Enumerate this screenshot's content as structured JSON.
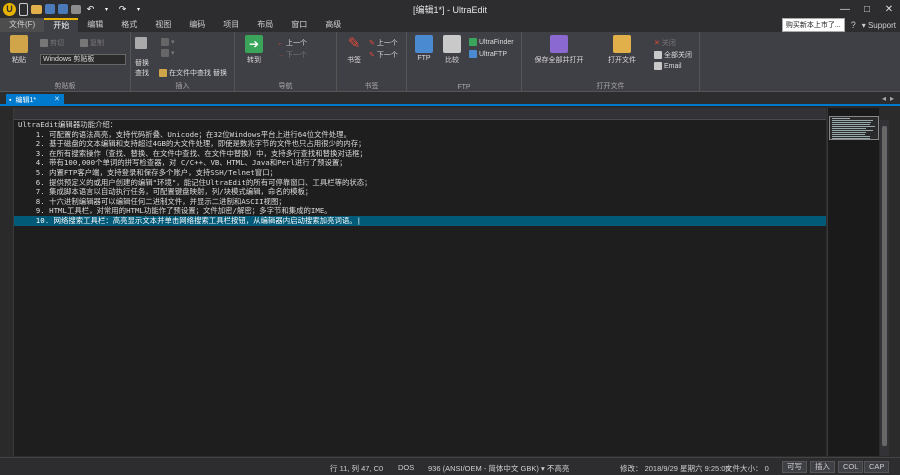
{
  "window": {
    "title": "[编辑1*] - UltraEdit",
    "controls": [
      "—",
      "□",
      "✕"
    ]
  },
  "menu": {
    "items": [
      "文件(F)",
      "开始",
      "编辑",
      "格式",
      "视图",
      "编码",
      "项目",
      "布局",
      "窗口",
      "高级"
    ],
    "active_index": 1,
    "promo": "购买新本上市了...",
    "support": "Support"
  },
  "ribbon": {
    "groups": [
      {
        "label": "剪贴板"
      },
      {
        "label": "插入"
      },
      {
        "label": "导航"
      },
      {
        "label": "书签"
      },
      {
        "label": "FTP"
      },
      {
        "label": "打开文件"
      }
    ],
    "clipboard": {
      "paste": "粘贴",
      "cut": "剪切",
      "copy": "复制",
      "combo": "Windows 剪贴板"
    },
    "insert": {
      "replace": "替换",
      "find": "查找",
      "find_in_files": "在文件中查找 替换"
    },
    "navigation": {
      "goto": "转到",
      "prev": "上一个",
      "next": "下一个"
    },
    "bookmarks": {
      "toggle": "书签",
      "prev": "上一个",
      "next": "下一个"
    },
    "ftp": {
      "ftp": "FTP",
      "compare": "比较",
      "ultrafinder": "UltraFinder",
      "ultraftp": "UltraFTP"
    },
    "open": {
      "save_to_project": "保存全部并打开",
      "open_file": "打开文件",
      "close": "关闭",
      "email": "Email",
      "close_all": "全部关闭"
    }
  },
  "tab": {
    "label": "编辑1*",
    "close": "✕"
  },
  "editor": {
    "lines": [
      "UltraEdit编辑器功能介绍：",
      "    1. 可配置的语法高亮，支持代码折叠、Unicode；在32位Windows平台上进行64位文件处理。",
      "    2. 基于磁盘的文本编辑和支持超过4GB的大文件处理，即使是数兆字节的文件也只占用很少的内存；",
      "    3. 在所有搜索操作（查找、替换、在文件中查找、在文件中替换）中，支持多行查找和替换对话框；",
      "    4. 带有100,000个单词的拼写检查器，对 C/C++、VB、HTML、Java和Perl进行了预设置；",
      "    5. 内置FTP客户端，支持登录和保存多个账户，支持SSH/Telnet窗口；",
      "    6. 提供预定义的或用户创建的编辑\"环境\"，能记住UltraEdit的所有可停靠窗口、工具栏等的状态；",
      "    7. 集成脚本语言以自动执行任务，可配置键盘映射，列/块模式编辑，命名的模板；",
      "    8. 十六进制编辑器可以编辑任何二进制文件，并显示二进制和ASCII视图；",
      "    9. HTML工具栏，对常用的HTML功能作了预设置；文件加密/解密；多字节和集成的IME。",
      "    10. 网络搜索工具栏：高亮显示文本并单击网络搜索工具栏按钮，从编辑器内启动搜索加亮词语。|"
    ],
    "current_line": 10
  },
  "status": {
    "position": "行 11, 列 47, C0",
    "line_ending": "DOS",
    "encoding": "936 (ANSI/OEM - 简体中文 GBK)",
    "highlight": "不高亮",
    "modified": "修改：  2018/9/29 星期六 9:25:00",
    "filesize": "文件大小：  0",
    "rw": "可写",
    "insert": "插入",
    "col": "COL",
    "cap": "CAP"
  },
  "colors": {
    "accent": "#007acc",
    "current_line": "#005a78",
    "active_menu_marker": "#e8b400"
  }
}
